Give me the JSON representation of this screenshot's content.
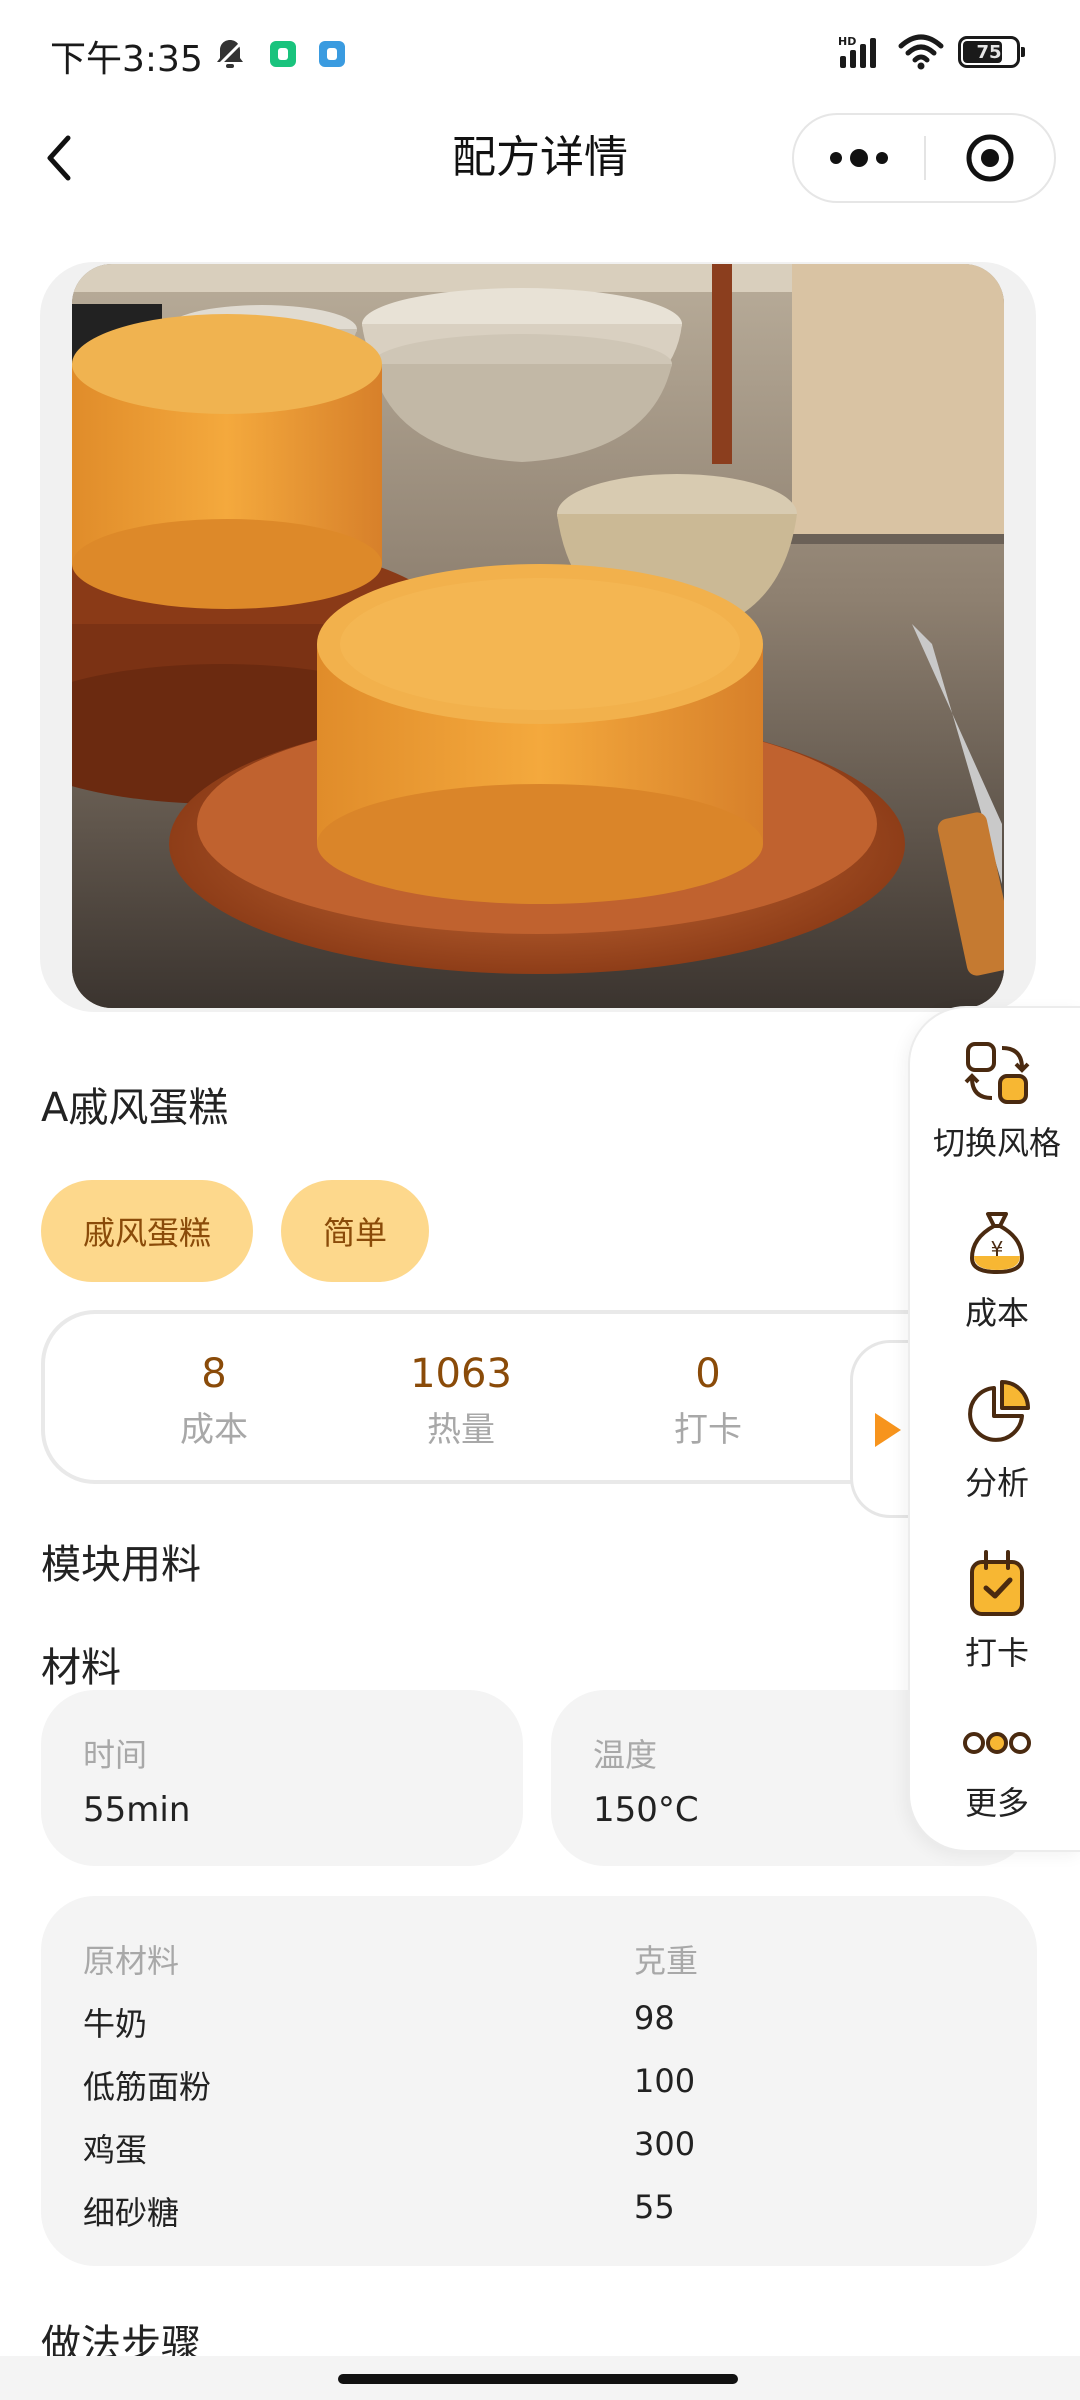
{
  "status_bar": {
    "time": "下午3:35",
    "battery": "75",
    "battery_level": 0.75
  },
  "nav": {
    "title": "配方详情"
  },
  "recipe": {
    "title": "A戚风蛋糕",
    "tags": [
      "戚风蛋糕",
      "简单"
    ],
    "stats": [
      {
        "value": "8",
        "label": "成本"
      },
      {
        "value": "1063",
        "label": "热量"
      },
      {
        "value": "0",
        "label": "打卡"
      }
    ]
  },
  "sections": {
    "module_title": "模块用料",
    "material_title": "材料",
    "steps_title": "做法步骤"
  },
  "info": {
    "time_label": "时间",
    "time_value": "55min",
    "temp_label": "温度",
    "temp_value": "150°C"
  },
  "ingredients": {
    "header": [
      "原材料",
      "克重"
    ],
    "rows": [
      [
        "牛奶",
        "98"
      ],
      [
        "低筋面粉",
        "100"
      ],
      [
        "鸡蛋",
        "300"
      ],
      [
        "细砂糖",
        "55"
      ]
    ]
  },
  "float_menu": {
    "items": [
      {
        "label": "切换风格",
        "icon": "switch-style-icon"
      },
      {
        "label": "成本",
        "icon": "money-bag-icon"
      },
      {
        "label": "分析",
        "icon": "pie-chart-icon"
      },
      {
        "label": "打卡",
        "icon": "checkin-icon"
      },
      {
        "label": "更多",
        "icon": "more-icon"
      }
    ]
  },
  "colors": {
    "accent": "#fdd88c",
    "accent_text": "#8a4b09",
    "arrow": "#f7941d",
    "card_bg": "#f4f4f4"
  }
}
